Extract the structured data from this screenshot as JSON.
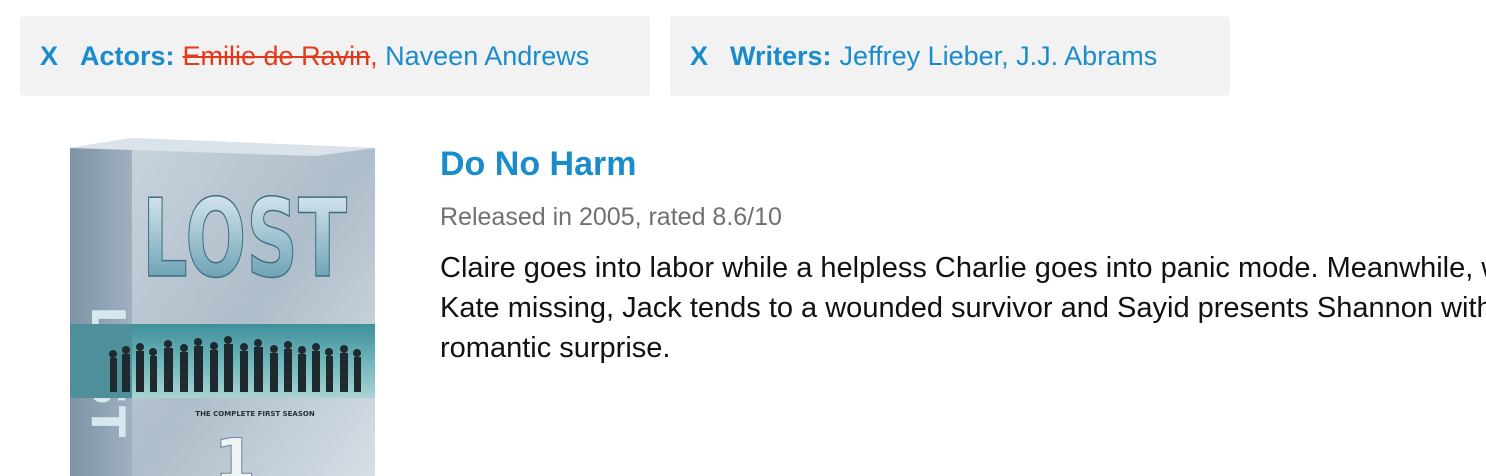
{
  "filters": [
    {
      "remove_label": "X",
      "label": "Actors:",
      "removed_value": "Emilie de Ravin",
      "removed_separator": ",",
      "values": "Naveen Andrews"
    },
    {
      "remove_label": "X",
      "label": "Writers:",
      "values": "Jeffrey Lieber, J.J. Abrams"
    }
  ],
  "result": {
    "title": "Do No Harm",
    "meta": "Released in 2005, rated 8.6/10",
    "description": "Claire goes into labor while a helpless Charlie goes into panic mode. Meanwhile, with Kate missing, Jack tends to a wounded survivor and Sayid presents Shannon with a romantic surprise.",
    "cover": {
      "logo_text": "LOST",
      "subtitle": "THE COMPLETE FIRST SEASON",
      "number": "1"
    }
  },
  "colors": {
    "link": "#1a8ccc",
    "removed": "#e23b1b",
    "chip_bg": "#f2f2f2"
  }
}
